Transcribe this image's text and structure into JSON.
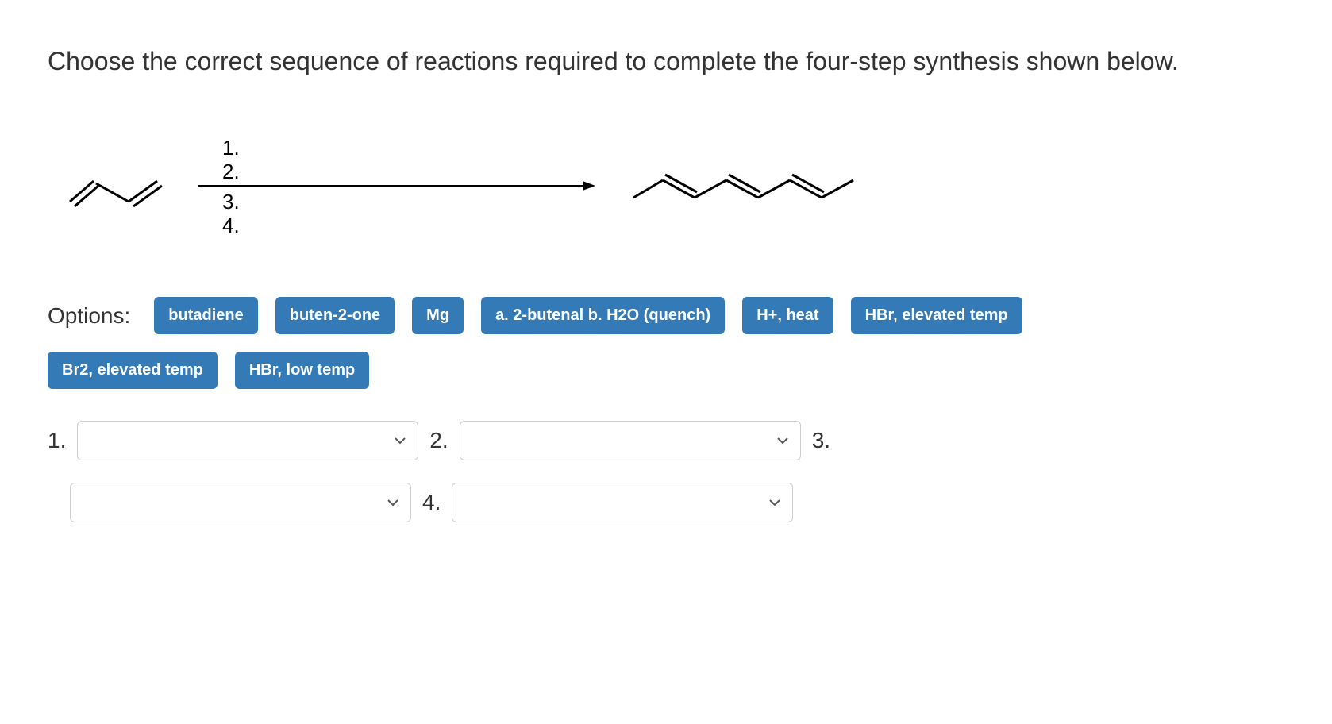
{
  "question": "Choose the correct sequence of reactions required to complete the four-step synthesis shown below.",
  "arrow_above": {
    "line1": "1.",
    "line2": "2."
  },
  "arrow_below": {
    "line1": "3.",
    "line2": "4."
  },
  "options_label": "Options:",
  "options": [
    "butadiene",
    "buten-2-one",
    "Mg",
    "a. 2-butenal b. H2O (quench)",
    "H+, heat",
    "HBr, elevated temp",
    "Br2, elevated temp",
    "HBr, low temp"
  ],
  "slots": {
    "s1": "1.",
    "s2": "2.",
    "s3": "3.",
    "s4": "4."
  }
}
